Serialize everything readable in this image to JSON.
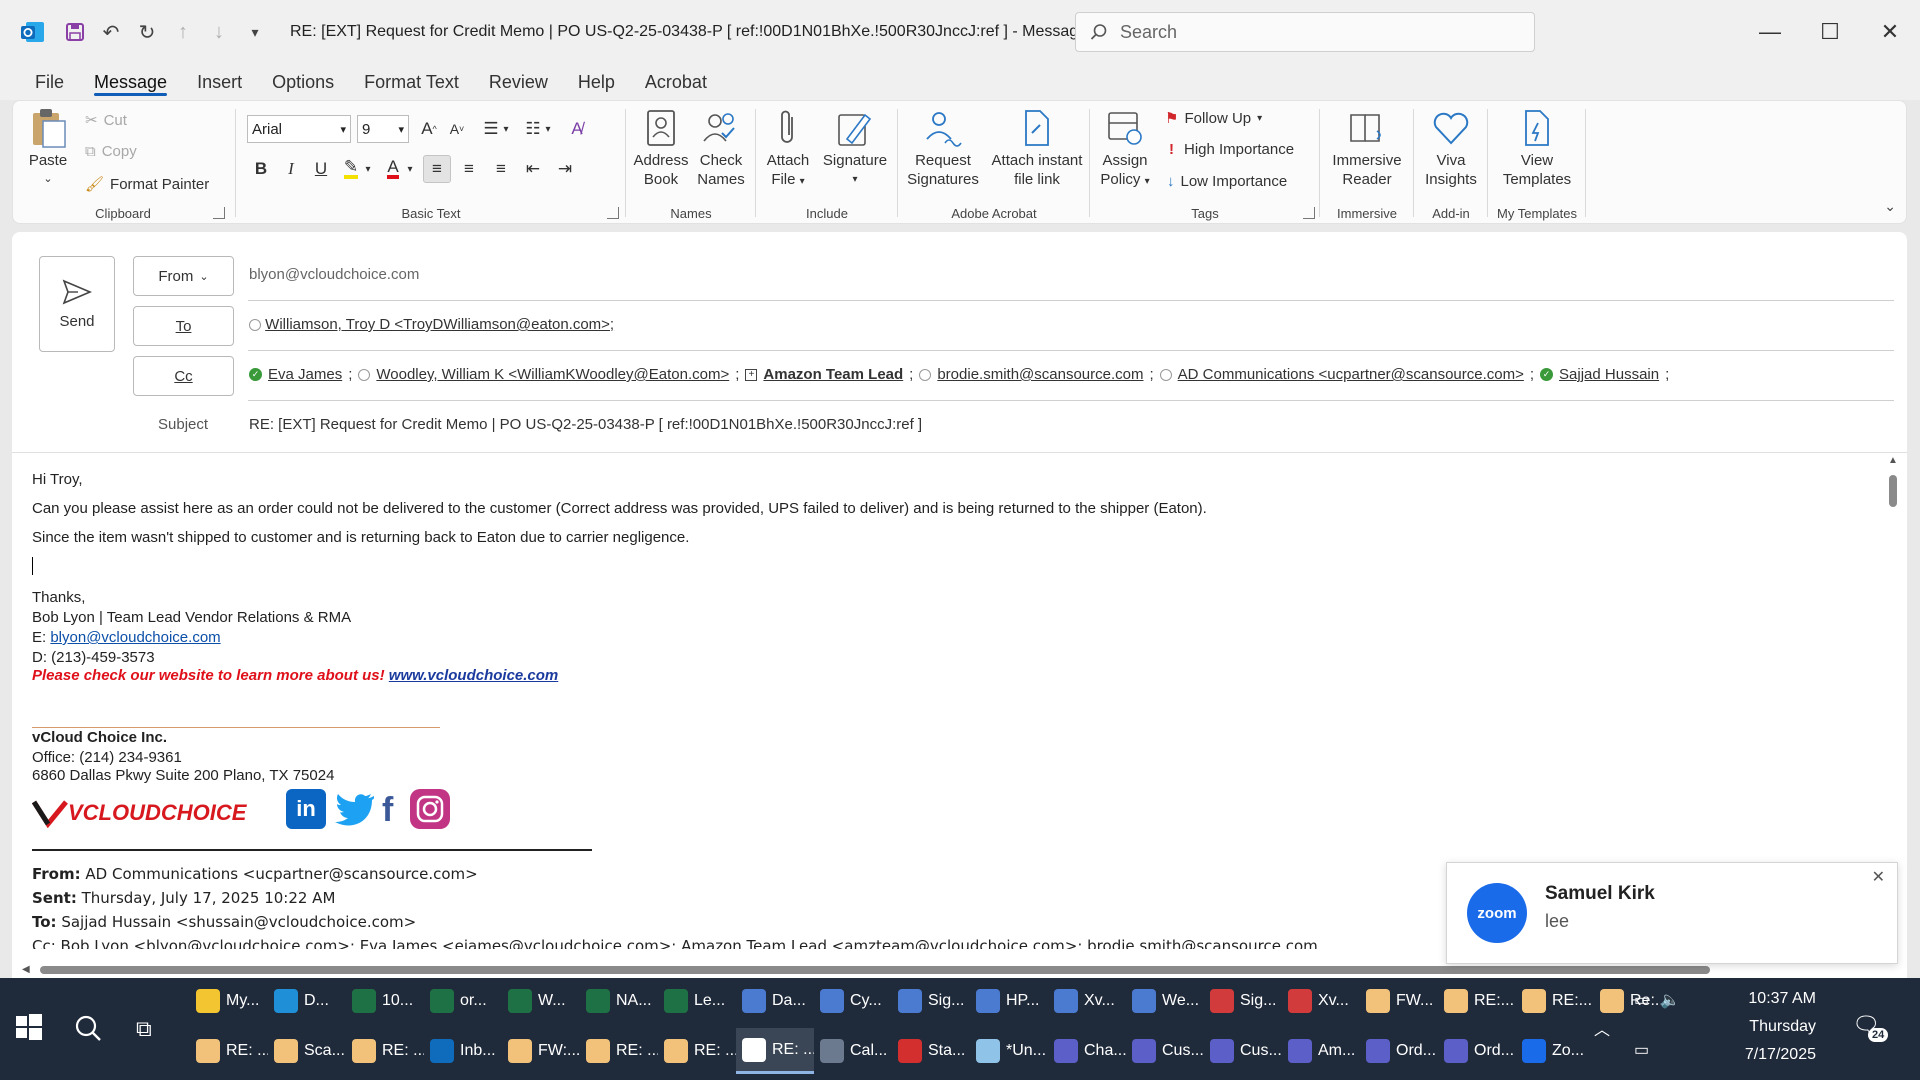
{
  "window": {
    "title": "RE: [EXT] Request for Credit Memo | PO US-Q2-25-03438-P    [ ref:!00D1N01BhXe.!500R30JnccJ:ref ]  -  Message (HT...",
    "search_placeholder": "Search"
  },
  "tabs": [
    "File",
    "Message",
    "Insert",
    "Options",
    "Format Text",
    "Review",
    "Help",
    "Acrobat"
  ],
  "ribbon": {
    "clipboard": {
      "paste": "Paste",
      "cut": "Cut",
      "copy": "Copy",
      "format_painter": "Format Painter",
      "label": "Clipboard"
    },
    "basic_text": {
      "font": "Arial",
      "size": "9",
      "label": "Basic Text"
    },
    "names": {
      "address_book_1": "Address",
      "address_book_2": "Book",
      "check_names_1": "Check",
      "check_names_2": "Names",
      "label": "Names"
    },
    "include": {
      "attach_1": "Attach",
      "attach_2": "File",
      "signature": "Signature",
      "label": "Include"
    },
    "adobe": {
      "request_1": "Request",
      "request_2": "Signatures",
      "attach_link_1": "Attach instant",
      "attach_link_2": "file link",
      "label": "Adobe Acrobat"
    },
    "tags": {
      "assign_1": "Assign",
      "assign_2": "Policy",
      "follow_up": "Follow Up",
      "high": "High Importance",
      "low": "Low Importance",
      "label": "Tags"
    },
    "immersive": {
      "reader_1": "Immersive",
      "reader_2": "Reader",
      "label": "Immersive"
    },
    "addin": {
      "viva_1": "Viva",
      "viva_2": "Insights",
      "label": "Add-in"
    },
    "templates": {
      "view_1": "View",
      "view_2": "Templates",
      "label": "My Templates"
    }
  },
  "compose": {
    "send": "Send",
    "from_label": "From",
    "from_value": "blyon@vcloudchoice.com",
    "to_label": "To",
    "to_value": "Williamson, Troy D <TroyDWilliamson@eaton.com>;",
    "cc_label": "Cc",
    "cc": [
      {
        "name": "Eva James",
        "status": "online"
      },
      {
        "name": "Woodley, William K <WilliamKWoodley@Eaton.com>",
        "status": "unknown"
      },
      {
        "name": "Amazon Team Lead",
        "status": "group"
      },
      {
        "name": "brodie.smith@scansource.com",
        "status": "unknown"
      },
      {
        "name": "AD Communications <ucpartner@scansource.com>",
        "status": "unknown"
      },
      {
        "name": "Sajjad Hussain",
        "status": "online"
      }
    ],
    "subject_label": "Subject",
    "subject_value": "RE: [EXT] Request for Credit Memo | PO US-Q2-25-03438-P    [ ref:!00D1N01BhXe.!500R30JnccJ:ref ]"
  },
  "body": {
    "greeting": "Hi Troy,",
    "p1": "Can you please assist here as an order could not be delivered to the customer (Correct address was provided, UPS failed to deliver) and is being returned to the shipper (Eaton).",
    "p2": "Since the item wasn't shipped to customer and is returning back to Eaton due to carrier negligence.",
    "thanks": "Thanks,",
    "sig_name": "Bob Lyon | Team Lead Vendor Relations & RMA",
    "sig_email_label": "E: ",
    "sig_email": "blyon@vcloudchoice.com",
    "sig_phone": "D: (213)-459-3573",
    "sig_promo": "Please check our website to learn more about us! ",
    "sig_url": "www.vcloudchoice.com",
    "company": "vCloud Choice Inc.",
    "office": "Office: (214) 234-9361",
    "address": "6860 Dallas Pkwy Suite 200 Plano, TX 75024",
    "logo_text": "VCLOUDCHOICE",
    "fwd_from_label": "From:",
    "fwd_from": " AD Communications <ucpartner@scansource.com>",
    "fwd_sent_label": "Sent:",
    "fwd_sent": " Thursday, July 17, 2025 10:22 AM",
    "fwd_to_label": "To:",
    "fwd_to": " Sajjad Hussain <shussain@vcloudchoice.com>",
    "fwd_cc": "Cc: Bob Lyon <blyon@vcloudchoice.com>; Eva James <ejames@vcloudchoice.com>; Amazon Team Lead <amzteam@vcloudchoice.com>; brodie.smith@scansource.com"
  },
  "toast": {
    "app": "zoom",
    "name": "Samuel Kirk",
    "message": "lee"
  },
  "taskbar": {
    "row1": [
      {
        "label": "My...",
        "icon": "folder-icon",
        "color": "#f2c531"
      },
      {
        "label": "D...",
        "icon": "edge-icon",
        "color": "#1f8fd8"
      },
      {
        "label": "10...",
        "icon": "excel-icon",
        "color": "#1e7145"
      },
      {
        "label": "or...",
        "icon": "excel-icon",
        "color": "#1e7145"
      },
      {
        "label": "W...",
        "icon": "excel-icon",
        "color": "#1e7145"
      },
      {
        "label": "NA...",
        "icon": "excel-icon",
        "color": "#1e7145"
      },
      {
        "label": "Le...",
        "icon": "excel-icon",
        "color": "#1e7145"
      },
      {
        "label": "Da...",
        "icon": "chrome-icon",
        "color": "#4a7bd1"
      },
      {
        "label": "Cy...",
        "icon": "chrome-icon",
        "color": "#4a7bd1"
      },
      {
        "label": "Sig...",
        "icon": "chrome-icon",
        "color": "#4a7bd1"
      },
      {
        "label": "HP...",
        "icon": "chrome-icon",
        "color": "#4a7bd1"
      },
      {
        "label": "Xv...",
        "icon": "chrome-icon",
        "color": "#4a7bd1"
      },
      {
        "label": "We...",
        "icon": "chrome-icon",
        "color": "#4a7bd1"
      },
      {
        "label": "Sig...",
        "icon": "chrome-icon",
        "color": "#d13b3b"
      },
      {
        "label": "Xv...",
        "icon": "chrome-icon",
        "color": "#d13b3b"
      },
      {
        "label": "FW...",
        "icon": "mail-icon",
        "color": "#f2c27a"
      },
      {
        "label": "RE:...",
        "icon": "mail-icon",
        "color": "#f2c27a"
      },
      {
        "label": "RE:...",
        "icon": "mail-icon",
        "color": "#f2c27a"
      },
      {
        "label": "Re:...",
        "icon": "mail-icon",
        "color": "#f2c27a"
      }
    ],
    "row2": [
      {
        "label": "RE: ...",
        "icon": "mail-icon",
        "color": "#f2c27a"
      },
      {
        "label": "Sca...",
        "icon": "mail-icon",
        "color": "#f2c27a"
      },
      {
        "label": "RE: ...",
        "icon": "mail-icon",
        "color": "#f2c27a"
      },
      {
        "label": "Inb...",
        "icon": "outlook-icon",
        "color": "#0f6cbd"
      },
      {
        "label": "FW:...",
        "icon": "mail-icon",
        "color": "#f2c27a"
      },
      {
        "label": "RE: ...",
        "icon": "mail-icon",
        "color": "#f2c27a"
      },
      {
        "label": "RE: ...",
        "icon": "mail-icon",
        "color": "#f2c27a"
      },
      {
        "label": "RE: ...",
        "icon": "mail-icon",
        "color": "#ffffff"
      },
      {
        "label": "Cal...",
        "icon": "calculator-icon",
        "color": "#6b7a8f"
      },
      {
        "label": "Sta...",
        "icon": "pdf-icon",
        "color": "#d32f2f"
      },
      {
        "label": "*Un...",
        "icon": "notepad-icon",
        "color": "#8fc4e8"
      },
      {
        "label": "Cha...",
        "icon": "teams-icon",
        "color": "#5b5fc7"
      },
      {
        "label": "Cus...",
        "icon": "teams-icon",
        "color": "#5b5fc7"
      },
      {
        "label": "Cus...",
        "icon": "teams-icon",
        "color": "#5b5fc7"
      },
      {
        "label": "Am...",
        "icon": "teams-icon",
        "color": "#5b5fc7"
      },
      {
        "label": "Ord...",
        "icon": "teams-icon",
        "color": "#5b5fc7"
      },
      {
        "label": "Ord...",
        "icon": "teams-icon",
        "color": "#5b5fc7"
      },
      {
        "label": "Zo...",
        "icon": "zoom-icon",
        "color": "#1a6bea"
      }
    ],
    "time": "10:37 AM",
    "day": "Thursday",
    "date": "7/17/2025",
    "notif_count": "24"
  },
  "colors": {
    "accent": "#0f5db6",
    "link": "#0b4fa8",
    "promo_red": "#e0101a",
    "taskbar": "#1f2a3a"
  }
}
